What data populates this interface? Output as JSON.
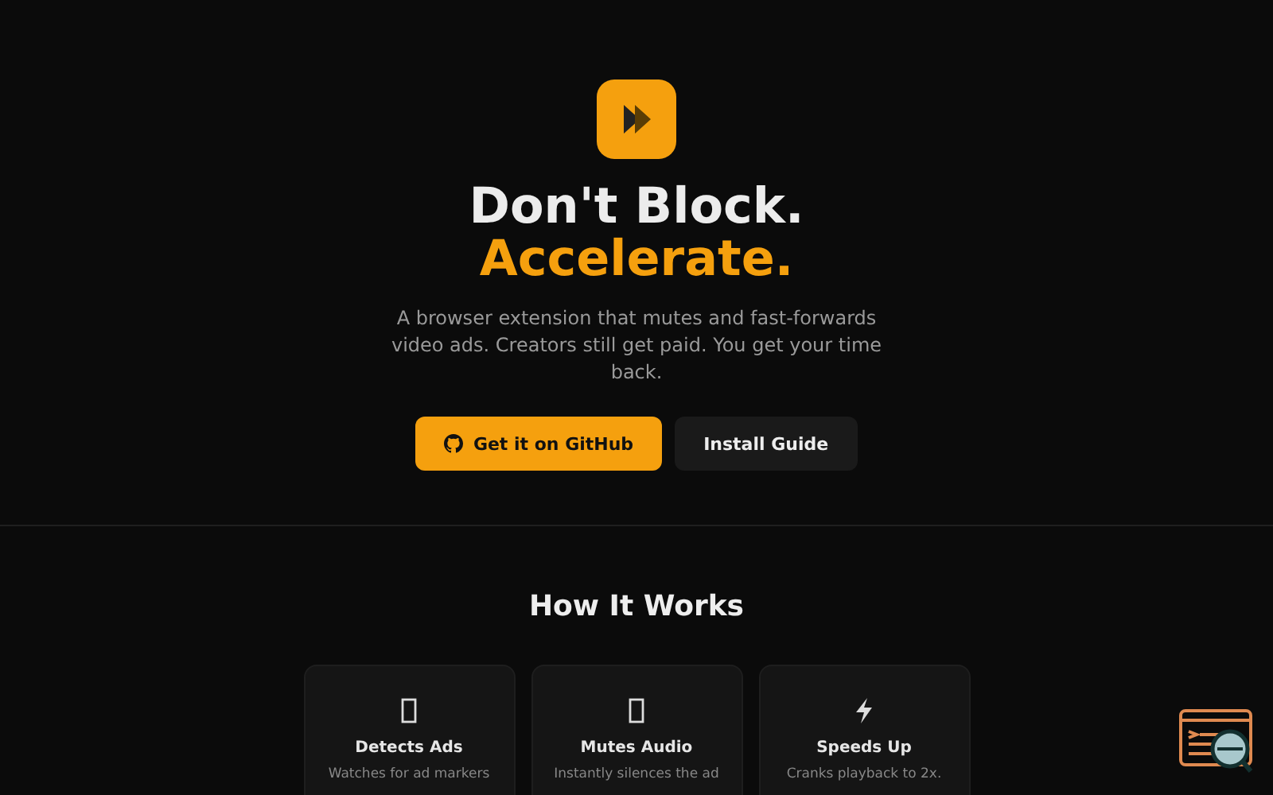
{
  "hero": {
    "title_line_1": "Don't Block.",
    "title_line_2": "Accelerate.",
    "description": "A browser extension that mutes and fast-forwards video ads. Creators still get paid. You get your time back.",
    "buttons": [
      {
        "label": "Get it on GitHub",
        "kind": "primary"
      },
      {
        "label": "Install Guide",
        "kind": "secondary"
      }
    ]
  },
  "how_it_works": {
    "heading": "How It Works",
    "cards": [
      {
        "kind": "missing",
        "title": "Detects Ads",
        "text": "Watches for ad markers"
      },
      {
        "kind": "missing",
        "title": "Mutes Audio",
        "text": "Instantly silences the ad"
      },
      {
        "kind": "bolt",
        "title": "Speeds Up",
        "text": "Cranks playback to 2x."
      }
    ]
  }
}
